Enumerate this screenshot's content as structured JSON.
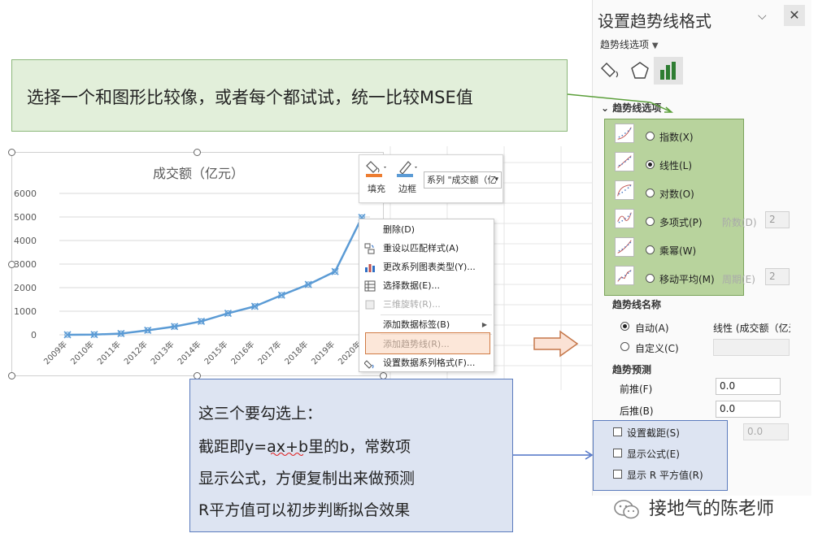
{
  "top_callout": {
    "text": "选择一个和图形比较像，或者每个都试试，统一比较MSE值"
  },
  "chart": {
    "title": "成交额（亿元）",
    "y_ticks": [
      "6000",
      "5000",
      "4000",
      "3000",
      "2000",
      "1000",
      "0"
    ]
  },
  "chart_data": {
    "type": "line",
    "title": "成交额（亿元）",
    "categories": [
      "2009年",
      "2010年",
      "2011年",
      "2012年",
      "2013年",
      "2014年",
      "2015年",
      "2016年",
      "2017年",
      "2018年",
      "2019年",
      "2020年"
    ],
    "series": [
      {
        "name": "成交额",
        "values": [
          0.5,
          9,
          52,
          191,
          350,
          571,
          912,
          1207,
          1682,
          2135,
          2684,
          4982
        ]
      }
    ],
    "ylim": [
      0,
      6000
    ],
    "grid": true,
    "color": "#5b9bd5"
  },
  "mini_toolbar": {
    "fill_label": "填充",
    "border_label": "边框",
    "series_select": "系列 \"成交额（亿"
  },
  "context_menu": {
    "items": [
      {
        "label": "删除(D)",
        "icon": "delete-icon",
        "disabled": false
      },
      {
        "label": "重设以匹配样式(A)",
        "icon": "reset-style-icon",
        "disabled": false
      },
      {
        "label": "更改系列图表类型(Y)...",
        "icon": "chart-type-icon",
        "disabled": false
      },
      {
        "label": "选择数据(E)...",
        "icon": "select-data-icon",
        "disabled": false
      },
      {
        "label": "三维旋转(R)...",
        "icon": "3d-rotate-icon",
        "disabled": true
      },
      {
        "label": "添加数据标签(B)",
        "icon": "",
        "disabled": false
      },
      {
        "label": "添加趋势线(R)...",
        "icon": "",
        "disabled": false
      },
      {
        "label": "设置数据系列格式(F)...",
        "icon": "format-series-icon",
        "disabled": false
      }
    ]
  },
  "pane": {
    "title": "设置趋势线格式",
    "options_dropdown": "趋势线选项",
    "section": "趋势线选项",
    "trend_types": [
      {
        "label": "指数(X)",
        "checked": false
      },
      {
        "label": "线性(L)",
        "checked": true
      },
      {
        "label": "对数(O)",
        "checked": false
      },
      {
        "label": "多项式(P)",
        "checked": false,
        "sub_label": "阶数(D)",
        "sub_value": "2"
      },
      {
        "label": "乘幂(W)",
        "checked": false
      },
      {
        "label": "移动平均(M)",
        "checked": false,
        "sub_label": "周期(E)",
        "sub_value": "2"
      }
    ],
    "name_section": "趋势线名称",
    "name_auto": "自动(A)",
    "name_auto_value": "线性 (成交额（亿元",
    "name_custom": "自定义(C)",
    "forecast_section": "趋势预测",
    "forward_label": "前推(F)",
    "forward_value": "0.0",
    "backward_label": "后推(B)",
    "backward_value": "0.0",
    "intercept_value": "0.0",
    "checkboxes": [
      "设置截距(S)",
      "显示公式(E)",
      "显示 R 平方值(R)"
    ]
  },
  "bottom_callout": {
    "lines": [
      "这三个要勾选上：",
      "截距即y=ax+b里的b，常数项",
      "显示公式，方便复制出来做预测",
      "R平方值可以初步判断拟合效果"
    ]
  },
  "watermark": {
    "text": "接地气的陈老师"
  }
}
